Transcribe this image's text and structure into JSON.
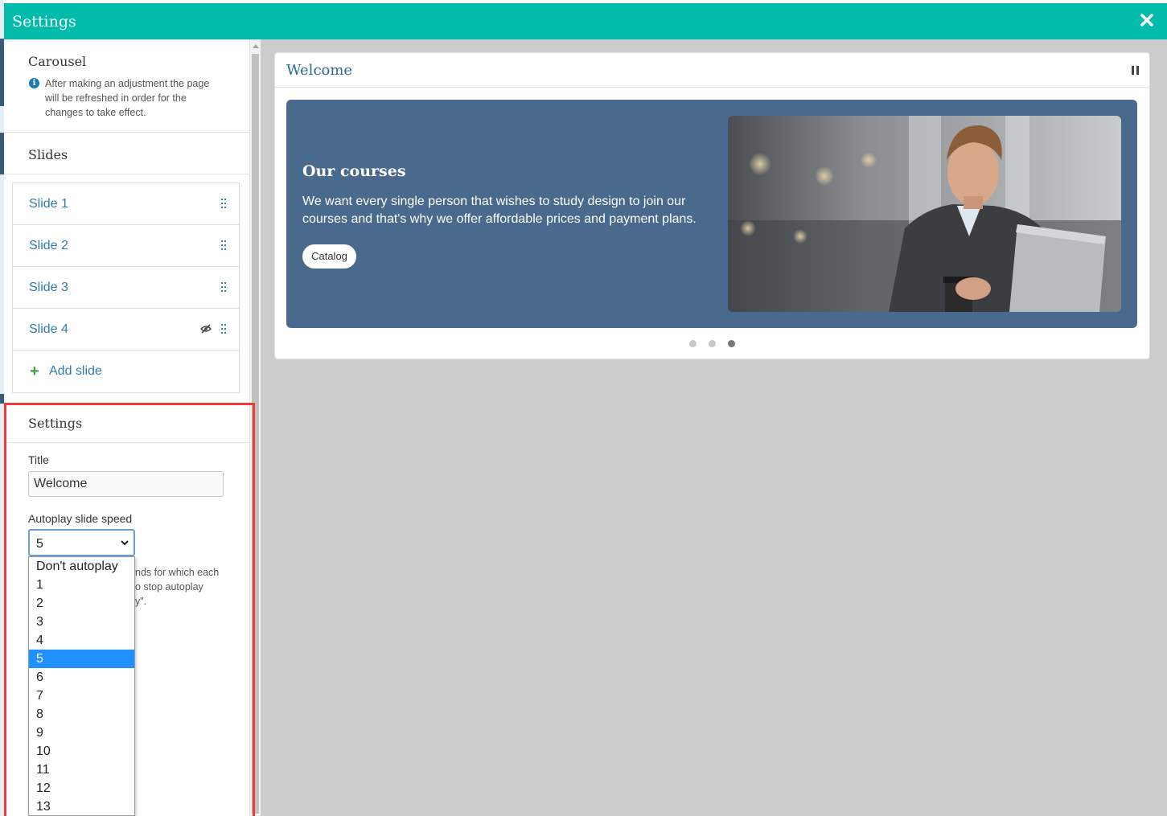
{
  "header": {
    "title": "Settings",
    "close_icon": "close-icon"
  },
  "sidebar": {
    "carousel_title": "Carousel",
    "info_text": "After making an adjustment the page will be refreshed in order for the changes to take effect.",
    "slides_title": "Slides",
    "slides": [
      {
        "label": "Slide 1",
        "hidden": false
      },
      {
        "label": "Slide 2",
        "hidden": false
      },
      {
        "label": "Slide 3",
        "hidden": false
      },
      {
        "label": "Slide 4",
        "hidden": true
      }
    ],
    "add_slide_label": "Add slide",
    "settings_title": "Settings",
    "title_label": "Title",
    "title_value": "Welcome",
    "autoplay_label": "Autoplay slide speed",
    "autoplay_value": "5",
    "help_text": "nds for which each\no stop autoplay\ny\".",
    "autoplay_options": [
      "Don't autoplay",
      "1",
      "2",
      "3",
      "4",
      "5",
      "6",
      "7",
      "8",
      "9",
      "10",
      "11",
      "12",
      "13"
    ],
    "autoplay_selected_index": 5
  },
  "preview": {
    "card_title": "Welcome",
    "slide_heading": "Our courses",
    "slide_text": "We want every single person that wishes to study design to join our courses and that's why we offer affordable prices and payment plans.",
    "button_label": "Catalog",
    "dots_count": 3,
    "active_dot": 3
  },
  "colors": {
    "header": "#01bcab",
    "slide_bg": "#496a8c",
    "link": "#2f7cb1",
    "highlight": "#ee3b3b",
    "selected_option": "#1e90ff"
  }
}
